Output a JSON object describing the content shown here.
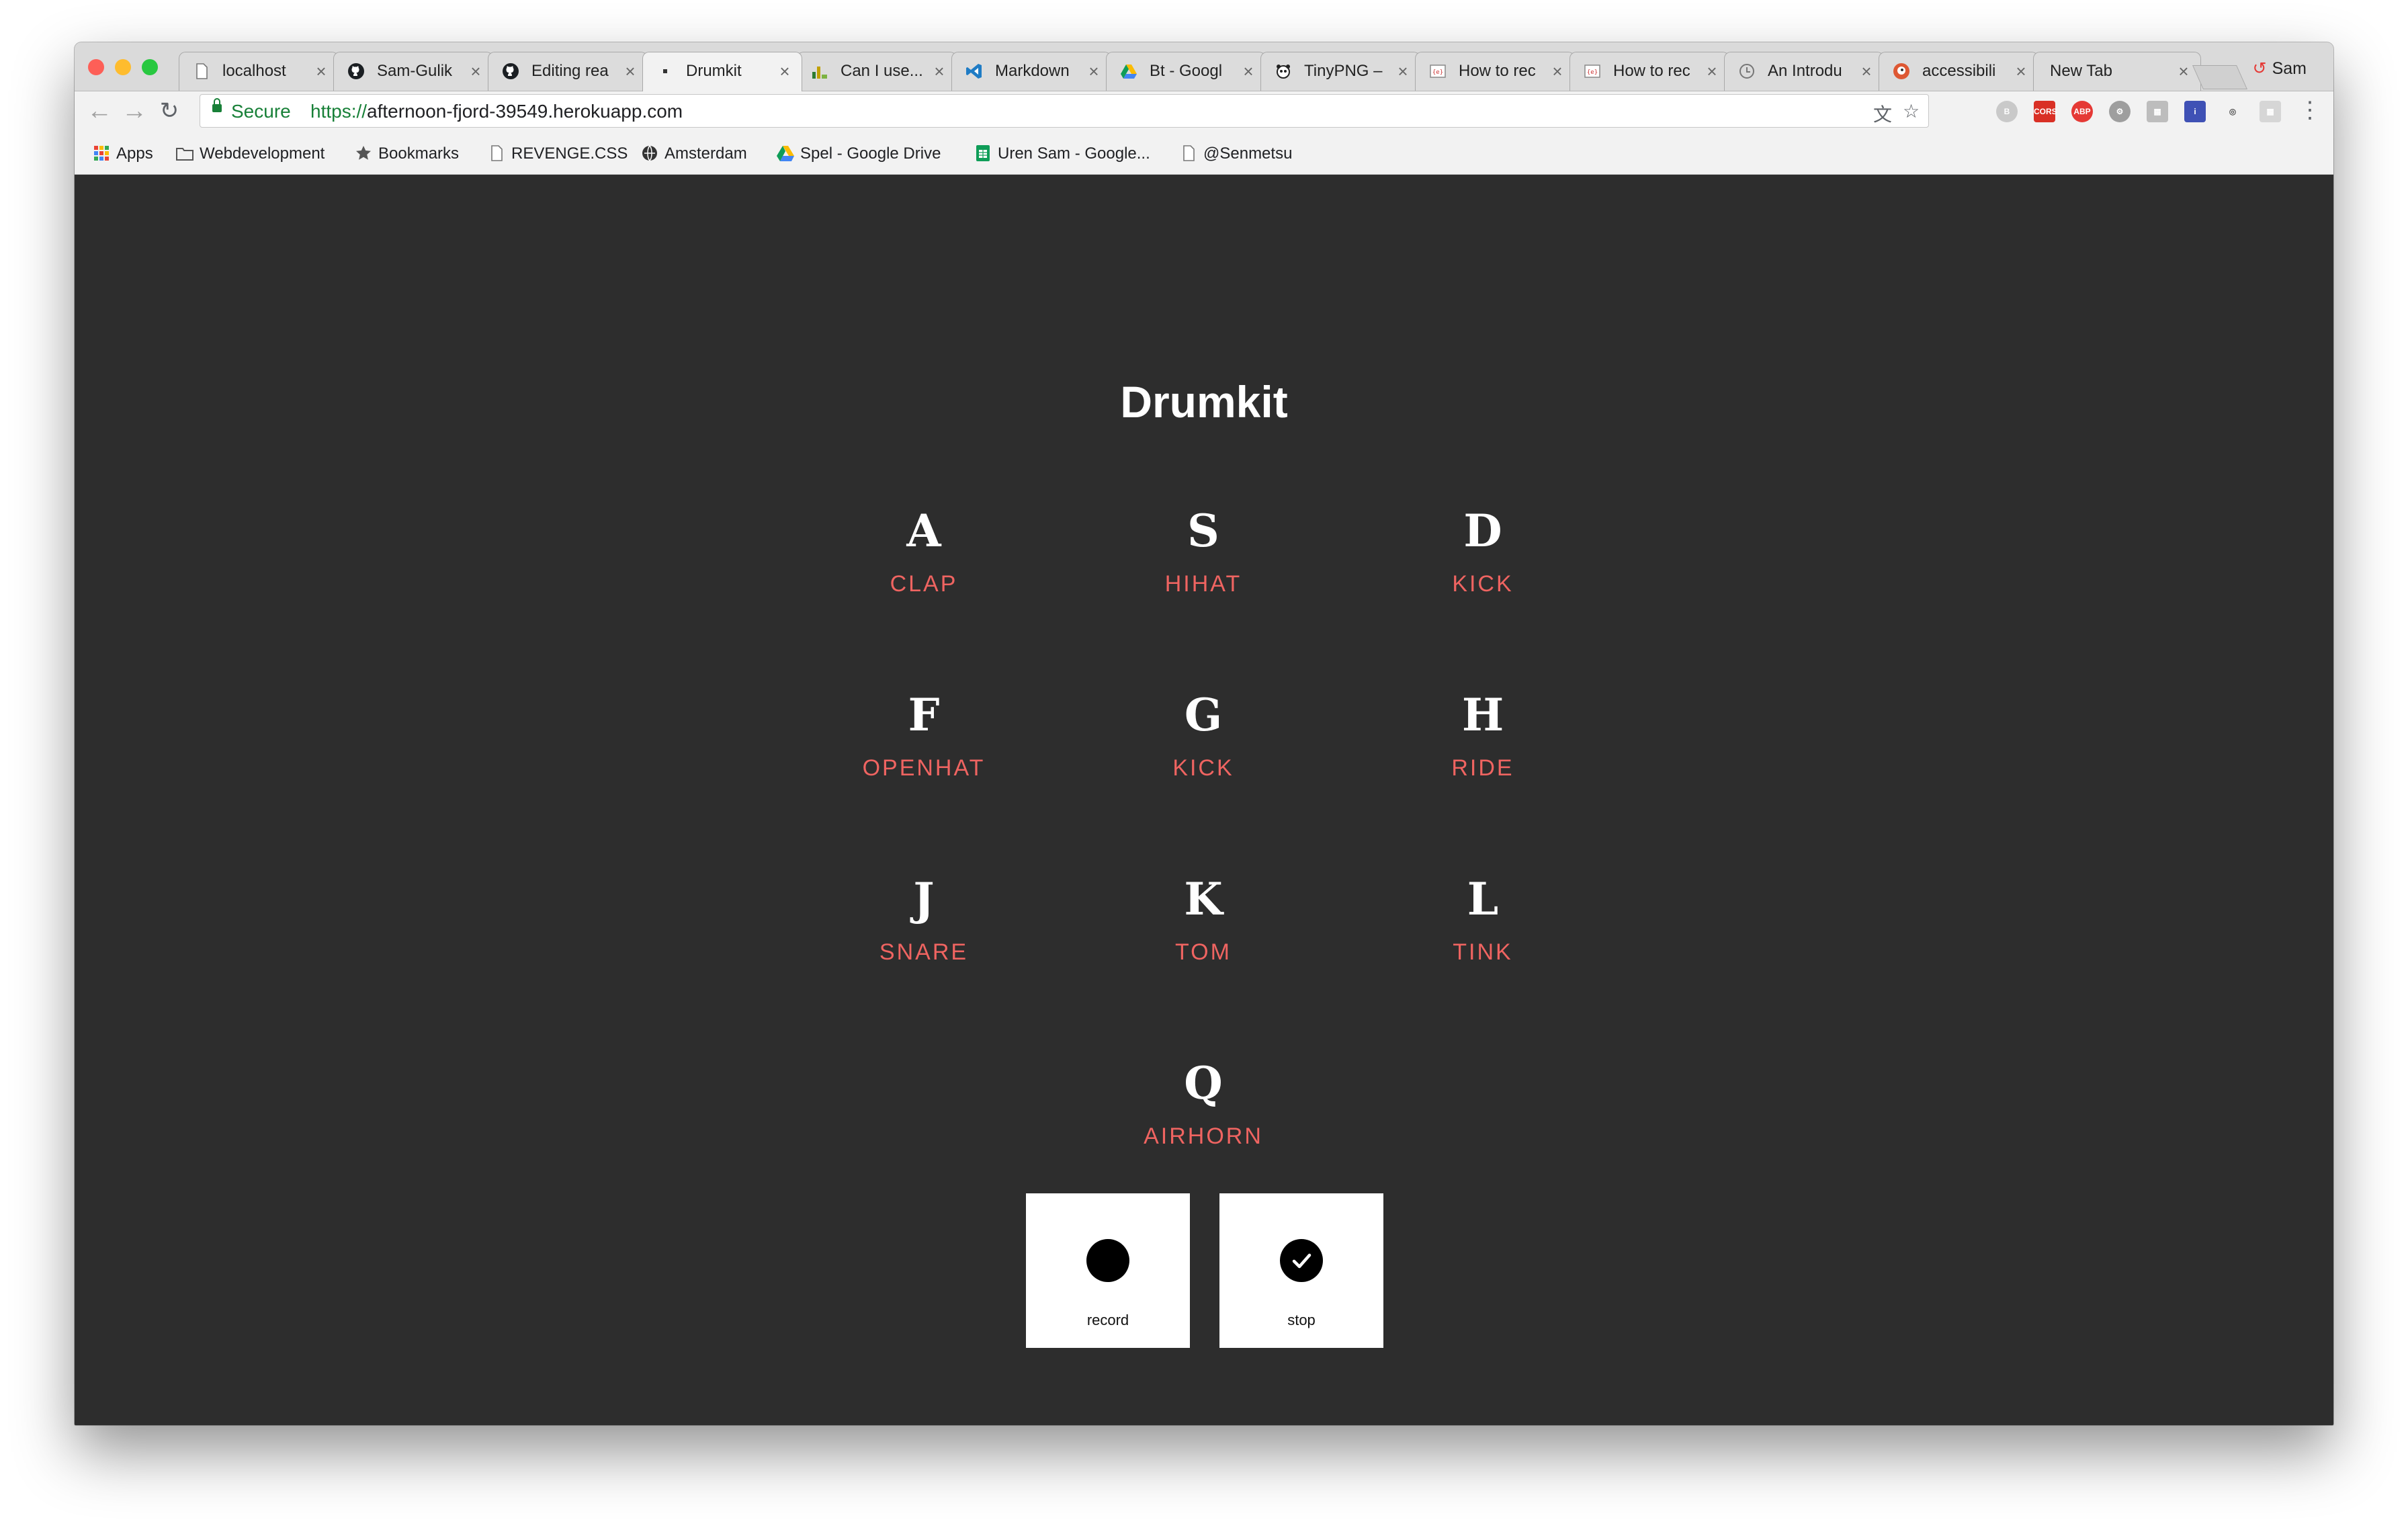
{
  "browser": {
    "tabs": [
      {
        "title": "localhost",
        "icon": "page-icon"
      },
      {
        "title": "Sam-Gulik",
        "icon": "github-icon"
      },
      {
        "title": "Editing rea",
        "icon": "github-icon"
      },
      {
        "title": "Drumkit",
        "icon": "dot-icon",
        "active": true
      },
      {
        "title": "Can I use...",
        "icon": "caniuse-icon"
      },
      {
        "title": "Markdown",
        "icon": "vscode-icon"
      },
      {
        "title": "Bt - Googl",
        "icon": "drive-icon"
      },
      {
        "title": "TinyPNG –",
        "icon": "panda-icon"
      },
      {
        "title": "How to rec",
        "icon": "code-icon"
      },
      {
        "title": "How to rec",
        "icon": "code-icon"
      },
      {
        "title": "An Introdu",
        "icon": "clock-icon"
      },
      {
        "title": "accessibili",
        "icon": "duckduckgo-icon"
      },
      {
        "title": "New Tab",
        "icon": "none"
      }
    ],
    "tab_close": "×",
    "profile": "Sam",
    "nav": {
      "back": "←",
      "forward": "→",
      "reload": "↻"
    },
    "secure_label": "Secure",
    "url_scheme": "https://",
    "url_host": "afternoon-fjord-39549.herokuapp.com",
    "bookmarks": [
      {
        "label": "Apps",
        "icon": "apps-grid-icon"
      },
      {
        "label": "Webdevelopment",
        "icon": "folder-icon"
      },
      {
        "label": "Bookmarks",
        "icon": "star-icon"
      },
      {
        "label": "REVENGE.CSS",
        "icon": "page-icon"
      },
      {
        "label": "Amsterdam",
        "icon": "globe-icon"
      },
      {
        "label": "Spel - Google Drive",
        "icon": "drive-icon"
      },
      {
        "label": "Uren Sam - Google...",
        "icon": "sheets-icon"
      },
      {
        "label": "@Senmetsu",
        "icon": "page-icon"
      }
    ],
    "colors": {
      "secure_green": "#188038",
      "tabstrip": "#dadada",
      "toolbar": "#f2f2f2"
    }
  },
  "page": {
    "title": "Drumkit",
    "pads": [
      {
        "key": "A",
        "sound": "CLAP"
      },
      {
        "key": "S",
        "sound": "HIHAT"
      },
      {
        "key": "D",
        "sound": "KICK"
      },
      {
        "key": "F",
        "sound": "OPENHAT"
      },
      {
        "key": "G",
        "sound": "KICK"
      },
      {
        "key": "H",
        "sound": "RIDE"
      },
      {
        "key": "J",
        "sound": "SNARE"
      },
      {
        "key": "K",
        "sound": "TOM"
      },
      {
        "key": "L",
        "sound": "TINK"
      },
      {
        "key": "Q",
        "sound": "AIRHORN"
      }
    ],
    "controls": {
      "record_label": "record",
      "stop_label": "stop",
      "stop_icon": "check-icon",
      "record_icon": "record-dot-icon"
    },
    "colors": {
      "background": "#2d2d2d",
      "sound_label": "#ef6461",
      "key": "#ffffff"
    }
  }
}
